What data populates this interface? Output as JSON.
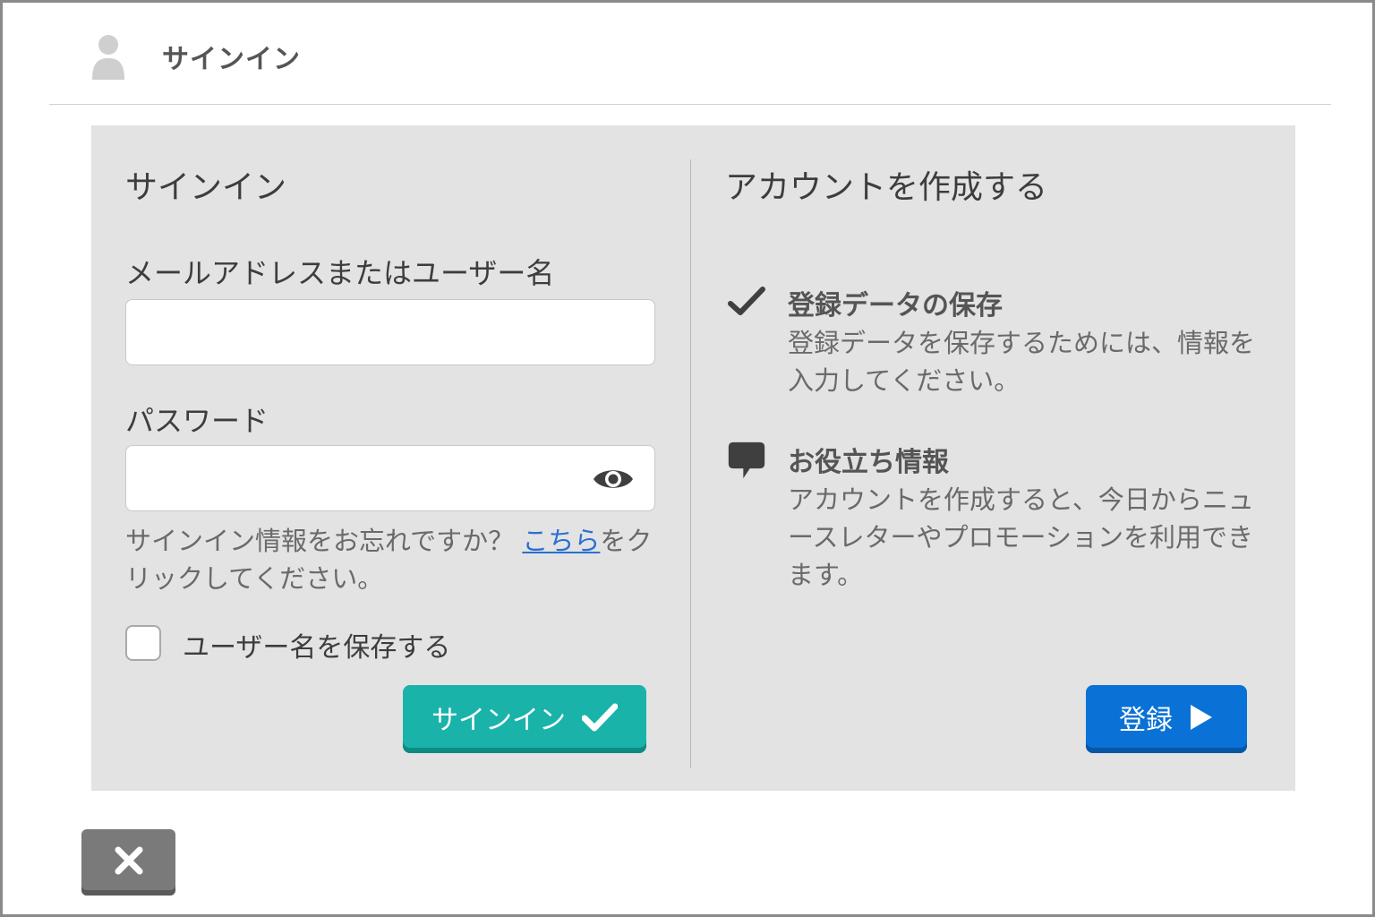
{
  "header": {
    "title": "サインイン",
    "icon": "user-icon"
  },
  "signin": {
    "title": "サインイン",
    "email_label": "メールアドレスまたはユーザー名",
    "email_value": "",
    "password_label": "パスワード",
    "password_value": "",
    "forgot_prefix": "サインイン情報をお忘れですか？",
    "forgot_link": "こちら",
    "forgot_suffix": "をクリックしてください。",
    "remember_label": "ユーザー名を保存する",
    "submit_label": "サインイン"
  },
  "register": {
    "title": "アカウントを作成する",
    "features": [
      {
        "icon": "checkmark-icon",
        "title": "登録データの保存",
        "desc": "登録データを保存するためには、情報を入力してください。"
      },
      {
        "icon": "speech-bubble-icon",
        "title": "お役立ち情報",
        "desc": "アカウントを作成すると、今日からニュースレターやプロモーションを利用できます。"
      }
    ],
    "submit_label": "登録"
  },
  "colors": {
    "signin_button": "#1ab3aa",
    "register_button": "#0a72d6",
    "close_button": "#7a7a7a",
    "panel": "#e3e3e3",
    "link": "#2a6fd1"
  }
}
